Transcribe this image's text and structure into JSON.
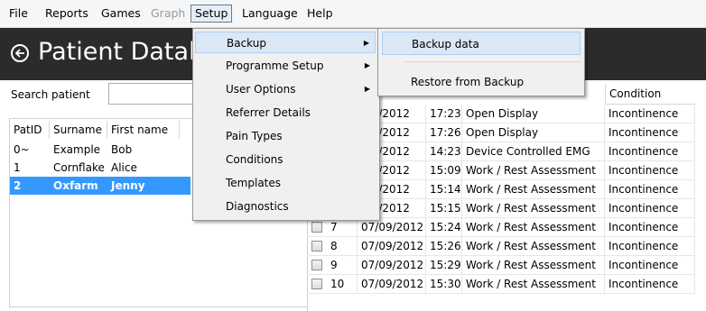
{
  "menubar": {
    "items": [
      {
        "label": "File",
        "state": "normal"
      },
      {
        "label": "Reports",
        "state": "normal"
      },
      {
        "label": "Games",
        "state": "normal"
      },
      {
        "label": "Graph",
        "state": "disabled"
      },
      {
        "label": "Setup",
        "state": "open"
      },
      {
        "label": "Language",
        "state": "normal"
      },
      {
        "label": "Help",
        "state": "normal"
      }
    ]
  },
  "header": {
    "title": "Patient Datab",
    "back_icon": "arrow-left-circle-icon",
    "background": "#2b2b2b"
  },
  "search": {
    "label": "Search patient",
    "value": ""
  },
  "patients": {
    "columns": [
      "PatID",
      "Surname",
      "First name"
    ],
    "rows": [
      {
        "id": "0~",
        "surname": "Example",
        "first": "Bob",
        "selected": false
      },
      {
        "id": "1",
        "surname": "Cornflake",
        "first": "Alice",
        "selected": false
      },
      {
        "id": "2",
        "surname": "Oxfarm",
        "first": "Jenny",
        "selected": true
      }
    ],
    "selected_color": "#3399ff"
  },
  "sessions": {
    "condition_header": "Condition",
    "rows": [
      {
        "num": "",
        "date": "/09/2012",
        "time": "17:23",
        "type": "Open Display",
        "condition": "Incontinence"
      },
      {
        "num": "",
        "date": "/09/2012",
        "time": "17:26",
        "type": "Open Display",
        "condition": "Incontinence"
      },
      {
        "num": "",
        "date": "/09/2012",
        "time": "14:23",
        "type": "Device Controlled EMG",
        "condition": "Incontinence"
      },
      {
        "num": "",
        "date": "/09/2012",
        "time": "15:09",
        "type": "Work / Rest Assessment",
        "condition": "Incontinence"
      },
      {
        "num": "",
        "date": "/09/2012",
        "time": "15:14",
        "type": "Work / Rest Assessment",
        "condition": "Incontinence"
      },
      {
        "num": "",
        "date": "/09/2012",
        "time": "15:15",
        "type": "Work / Rest Assessment",
        "condition": "Incontinence"
      },
      {
        "num": "7",
        "date": "07/09/2012",
        "time": "15:24",
        "type": "Work / Rest Assessment",
        "condition": "Incontinence"
      },
      {
        "num": "8",
        "date": "07/09/2012",
        "time": "15:26",
        "type": "Work / Rest Assessment",
        "condition": "Incontinence"
      },
      {
        "num": "9",
        "date": "07/09/2012",
        "time": "15:29",
        "type": "Work / Rest Assessment",
        "condition": "Incontinence"
      },
      {
        "num": "10",
        "date": "07/09/2012",
        "time": "15:30",
        "type": "Work / Rest Assessment",
        "condition": "Incontinence"
      }
    ]
  },
  "setup_menu": {
    "items": [
      {
        "label": "Backup",
        "submenu": true,
        "hover": true
      },
      {
        "label": "Programme Setup",
        "submenu": true,
        "hover": false
      },
      {
        "label": "User Options",
        "submenu": true,
        "hover": false
      },
      {
        "label": "Referrer Details",
        "submenu": false,
        "hover": false
      },
      {
        "label": "Pain Types",
        "submenu": false,
        "hover": false
      },
      {
        "label": "Conditions",
        "submenu": false,
        "hover": false
      },
      {
        "label": "Templates",
        "submenu": false,
        "hover": false
      },
      {
        "label": "Diagnostics",
        "submenu": false,
        "hover": false
      }
    ],
    "submenu_arrow": "▶"
  },
  "backup_menu": {
    "items": [
      {
        "label": "Backup data",
        "hover": true
      },
      {
        "label": "Restore from Backup",
        "hover": false
      }
    ]
  }
}
